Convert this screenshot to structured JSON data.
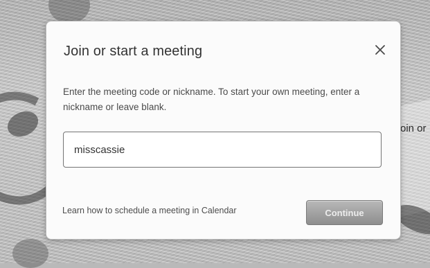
{
  "background": {
    "partial_label": "oin or"
  },
  "dialog": {
    "title": "Join or start a meeting",
    "description": "Enter the meeting code or nickname. To start your own meeting, enter a nickname or leave blank.",
    "input_value": "misscassie",
    "calendar_link": "Learn how to schedule a meeting in Calendar",
    "continue_label": "Continue",
    "close_icon": "close-icon"
  },
  "colors": {
    "dialog_bg": "#fbfbfb",
    "input_border": "#747474",
    "button_disabled": "#9a9a9a"
  }
}
